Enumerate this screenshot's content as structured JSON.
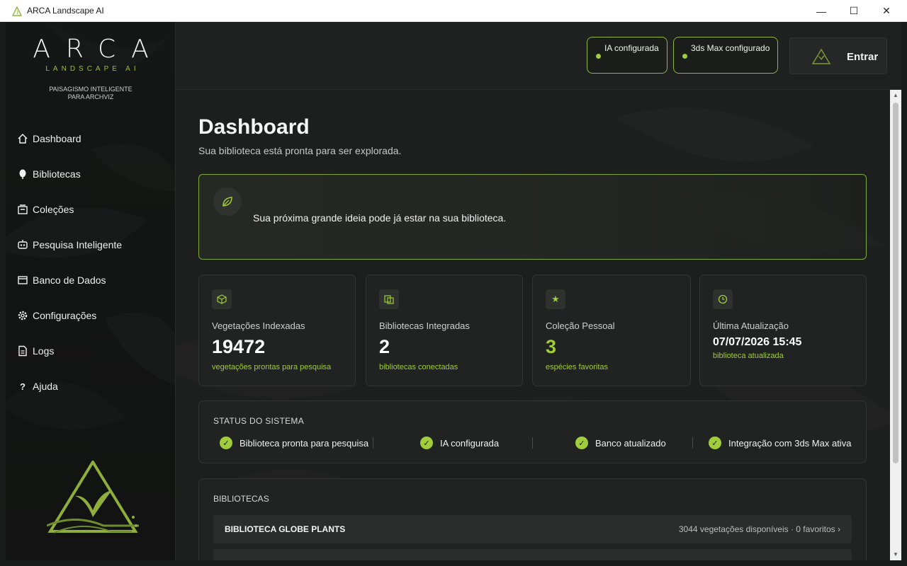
{
  "window": {
    "title": "ARCA Landscape AI",
    "controls": {
      "minimize": "—",
      "maximize": "☐",
      "close": "✕"
    }
  },
  "sidebar": {
    "brand": "ARCA",
    "brand_sub": "LANDSCAPE AI",
    "tagline_line1": "PAISAGISMO INTELIGENTE",
    "tagline_line2": "PARA ARCHVIZ",
    "items": [
      {
        "label": "Dashboard",
        "icon": "home-icon"
      },
      {
        "label": "Bibliotecas",
        "icon": "tree-icon"
      },
      {
        "label": "Coleções",
        "icon": "collection-icon"
      },
      {
        "label": "Pesquisa Inteligente",
        "icon": "robot-icon"
      },
      {
        "label": "Banco de Dados",
        "icon": "database-icon"
      },
      {
        "label": "Configurações",
        "icon": "gear-icon"
      },
      {
        "label": "Logs",
        "icon": "document-icon"
      },
      {
        "label": "Ajuda",
        "icon": "help-icon"
      }
    ]
  },
  "topbar": {
    "ia_status": "IA configurada",
    "max_status": "3ds Max configurado",
    "login_label": "Entrar"
  },
  "main": {
    "title": "Dashboard",
    "subtitle": "Sua biblioteca está pronta para ser explorada.",
    "banner_text": "Sua próxima grande ideia pode já estar na sua biblioteca.",
    "cards": [
      {
        "label": "Vegetações Indexadas",
        "value": "19472",
        "note": "vegetações prontas para pesquisa",
        "icon": "cube-icon"
      },
      {
        "label": "Bibliotecas Integradas",
        "value": "2",
        "note": "bibliotecas conectadas",
        "icon": "library-icon"
      },
      {
        "label": "Coleção Pessoal",
        "value": "3",
        "note": "espécies favoritas",
        "icon": "star-icon"
      },
      {
        "label": "Última Atualização",
        "value": "07/07/2026 15:45",
        "note": "biblioteca atualizada",
        "icon": "clock-icon"
      }
    ],
    "status": {
      "title": "STATUS DO SISTEMA",
      "items": [
        "Biblioteca pronta para pesquisa",
        "IA configurada",
        "Banco atualizado",
        "Integração com 3ds Max ativa"
      ]
    },
    "libraries": {
      "title": "BIBLIOTECAS",
      "rows": [
        {
          "name": "BIBLIOTECA GLOBE PLANTS",
          "meta": "3044 vegetações disponíveis · 0 favoritos ›"
        }
      ]
    }
  },
  "colors": {
    "accent": "#9fcd3b",
    "background": "#1d1e1e",
    "sidebar": "#141615"
  }
}
